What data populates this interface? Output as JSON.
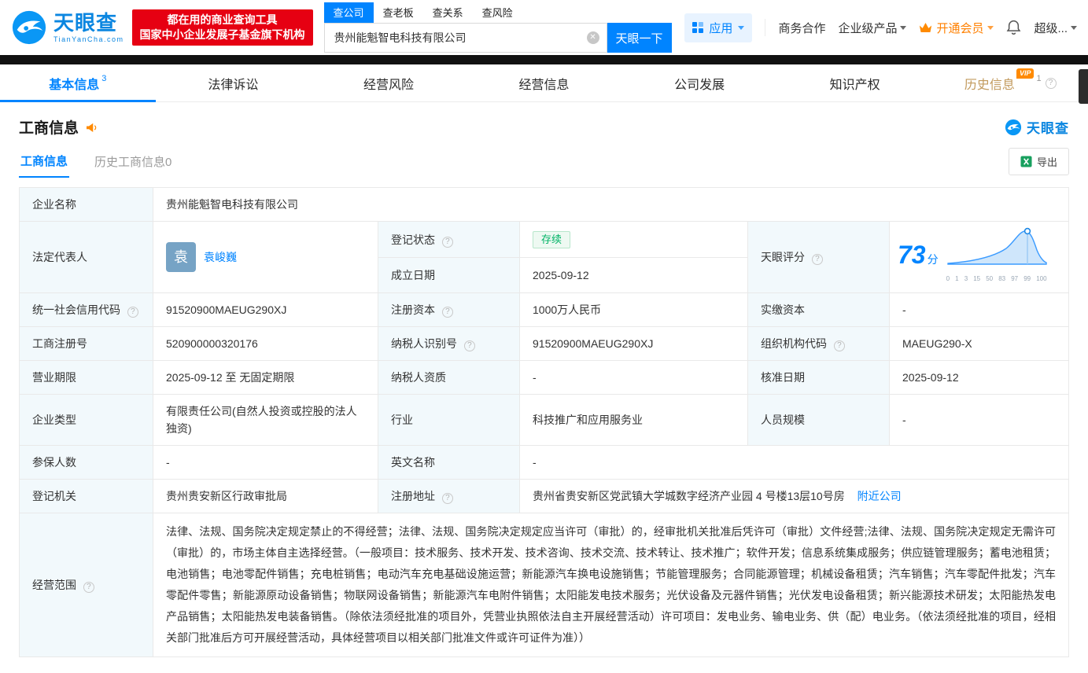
{
  "brand": {
    "name": "天眼查",
    "domain": "TianYanCha.com"
  },
  "header": {
    "promo": {
      "line1": "都在用的商业查询工具",
      "line2": "国家中小企业发展子基金旗下机构"
    },
    "search": {
      "tabs": [
        {
          "label": "查公司"
        },
        {
          "label": "查老板"
        },
        {
          "label": "查关系"
        },
        {
          "label": "查风险"
        }
      ],
      "value": "贵州能魁智电科技有限公司",
      "button": "天眼一下"
    },
    "actions": {
      "app": "应用",
      "cooperation": "商务合作",
      "enterprise": "企业级产品",
      "vip": "开通会员",
      "user": "超级..."
    }
  },
  "nav": {
    "tabs": [
      {
        "label": "基本信息",
        "count": "3"
      },
      {
        "label": "法律诉讼"
      },
      {
        "label": "经营风险"
      },
      {
        "label": "经营信息"
      },
      {
        "label": "公司发展"
      },
      {
        "label": "知识产权"
      },
      {
        "label": "历史信息",
        "count": "1",
        "vip": "VIP"
      }
    ]
  },
  "section": {
    "title": "工商信息",
    "brand": "天眼查",
    "subtabs": {
      "active": "工商信息",
      "history": "历史工商信息0"
    },
    "export": "导出"
  },
  "score": {
    "value": "73",
    "unit": "分",
    "axis": [
      "0",
      "1",
      "3",
      "15",
      "50",
      "83",
      "97",
      "99",
      "100"
    ]
  },
  "fields": {
    "company_name": {
      "label": "企业名称",
      "value": "贵州能魁智电科技有限公司"
    },
    "legal_rep": {
      "label": "法定代表人",
      "avatar": "袁",
      "value": "袁峻巍"
    },
    "reg_status": {
      "label": "登记状态",
      "value": "存续"
    },
    "establish_date": {
      "label": "成立日期",
      "value": "2025-09-12"
    },
    "tyc_score": {
      "label": "天眼评分"
    },
    "credit_code": {
      "label": "统一社会信用代码",
      "value": "91520900MAEUG290XJ"
    },
    "reg_capital": {
      "label": "注册资本",
      "value": "1000万人民币"
    },
    "paid_capital": {
      "label": "实缴资本",
      "value": "-"
    },
    "reg_no": {
      "label": "工商注册号",
      "value": "520900000320176"
    },
    "taxpayer_no": {
      "label": "纳税人识别号",
      "value": "91520900MAEUG290XJ"
    },
    "org_code": {
      "label": "组织机构代码",
      "value": "MAEUG290-X"
    },
    "business_term": {
      "label": "营业期限",
      "value": "2025-09-12 至 无固定期限"
    },
    "taxpayer_qualification": {
      "label": "纳税人资质",
      "value": "-"
    },
    "approval_date": {
      "label": "核准日期",
      "value": "2025-09-12"
    },
    "company_type": {
      "label": "企业类型",
      "value": "有限责任公司(自然人投资或控股的法人独资)"
    },
    "industry": {
      "label": "行业",
      "value": "科技推广和应用服务业"
    },
    "staff_size": {
      "label": "人员规模",
      "value": "-"
    },
    "insured_count": {
      "label": "参保人数",
      "value": "-"
    },
    "english_name": {
      "label": "英文名称",
      "value": "-"
    },
    "reg_authority": {
      "label": "登记机关",
      "value": "贵州贵安新区行政审批局"
    },
    "reg_address": {
      "label": "注册地址",
      "value": "贵州省贵安新区党武镇大学城数字经济产业园 4 号楼13层10号房",
      "link": "附近公司"
    },
    "business_scope": {
      "label": "经营范围",
      "value": "法律、法规、国务院决定规定禁止的不得经营；法律、法规、国务院决定规定应当许可（审批）的，经审批机关批准后凭许可（审批）文件经营;法律、法规、国务院决定规定无需许可（审批）的，市场主体自主选择经营。（一般项目：技术服务、技术开发、技术咨询、技术交流、技术转让、技术推广；软件开发；信息系统集成服务；供应链管理服务；蓄电池租赁；电池销售；电池零配件销售；充电桩销售；电动汽车充电基础设施运营；新能源汽车换电设施销售；节能管理服务；合同能源管理；机械设备租赁；汽车销售；汽车零配件批发；汽车零配件零售；新能源原动设备销售；物联网设备销售；新能源汽车电附件销售；太阳能发电技术服务；光伏设备及元器件销售；光伏发电设备租赁；新兴能源技术研发；太阳能热发电产品销售；太阳能热发电装备销售。（除依法须经批准的项目外，凭营业执照依法自主开展经营活动）许可项目：发电业务、输电业务、供（配）电业务。（依法须经批准的项目，经相关部门批准后方可开展经营活动，具体经营项目以相关部门批准文件或许可证件为准））"
    }
  }
}
